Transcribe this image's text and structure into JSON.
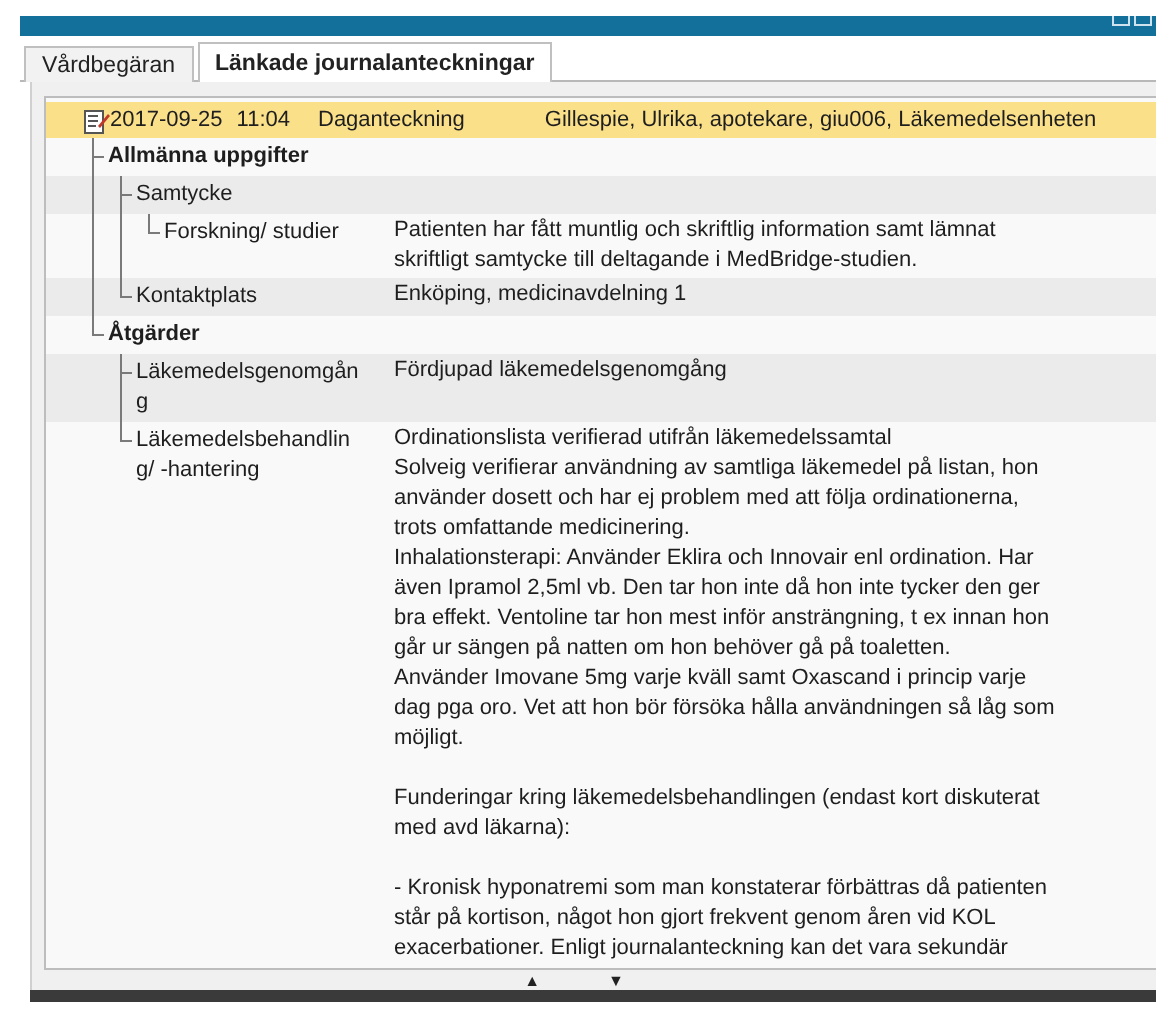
{
  "tabs": [
    {
      "label": "Vårdbegäran",
      "selected": false
    },
    {
      "label": "Länkade journalanteckningar",
      "selected": true
    }
  ],
  "entry": {
    "date": "2017-09-25",
    "time": "11:04",
    "type": "Daganteckning",
    "author": "Gillespie, Ulrika, apotekare, giu006, Läkemedelsenheten"
  },
  "tree": [
    {
      "label": "Allmänna uppgifter",
      "kind": "heading",
      "children": [
        {
          "label": "Samtycke",
          "kind": "field",
          "children": [
            {
              "label": "Forskning/ studier",
              "kind": "field",
              "value": "Patienten har fått muntlig och skriftlig information samt lämnat skriftligt samtycke till deltagande i MedBridge-studien."
            }
          ]
        },
        {
          "label": "Kontaktplats",
          "kind": "field",
          "value": "Enköping, medicinavdelning 1"
        }
      ]
    },
    {
      "label": "Åtgärder",
      "kind": "heading",
      "children": [
        {
          "label": "Läkemedelsgenomgång",
          "kind": "field",
          "value": "Fördjupad läkemedelsgenomgång"
        },
        {
          "label": "Läkemedelsbehandling/ -hantering",
          "kind": "field",
          "value": "Ordinationslista verifierad utifrån läkemedelssamtal\nSolveig verifierar användning av samtliga läkemedel på listan, hon använder dosett och har ej problem med att följa ordinationerna, trots omfattande medicinering.\nInhalationsterapi: Använder Eklira och Innovair enl ordination. Har även Ipramol 2,5ml vb. Den tar hon inte då hon inte tycker den ger bra effekt. Ventoline tar hon mest inför ansträngning, t ex innan hon går ur sängen på natten om hon behöver gå på toaletten.\nAnvänder Imovane 5mg varje kväll samt Oxascand i princip varje dag pga oro. Vet att hon bör försöka hålla användningen så låg som möjligt.\n\nFunderingar kring läkemedelsbehandlingen (endast kort diskuterat med avd läkarna):\n\n- Kronisk hyponatremi som man konstaterar förbättras då patienten står på kortison, något hon gjort frekvent genom åren vid KOL exacerbationer. Enligt journalanteckning kan det vara sekundär"
        }
      ]
    }
  ],
  "splitter": {
    "up": "▲",
    "down": "▼"
  }
}
